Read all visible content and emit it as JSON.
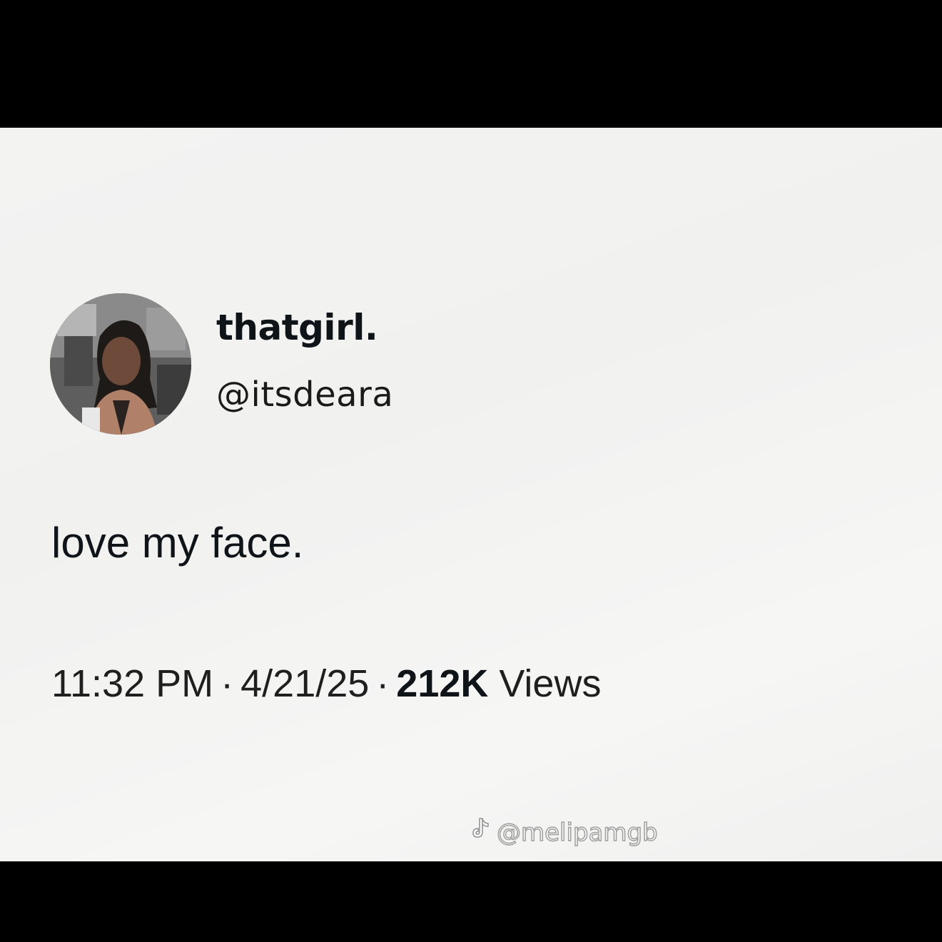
{
  "tweet": {
    "display_name": "thatgirl.",
    "handle": "@itsdeara",
    "text": "love my face.",
    "time": "11:32 PM",
    "date": "4/21/25",
    "views_count": "212K",
    "views_label": "Views",
    "separator": "·"
  },
  "watermark": {
    "icon": "tiktok-icon",
    "text": "@melipamgb"
  },
  "colors": {
    "background": "#f2f2f1",
    "letterbox": "#000000",
    "text": "#0f1419"
  }
}
